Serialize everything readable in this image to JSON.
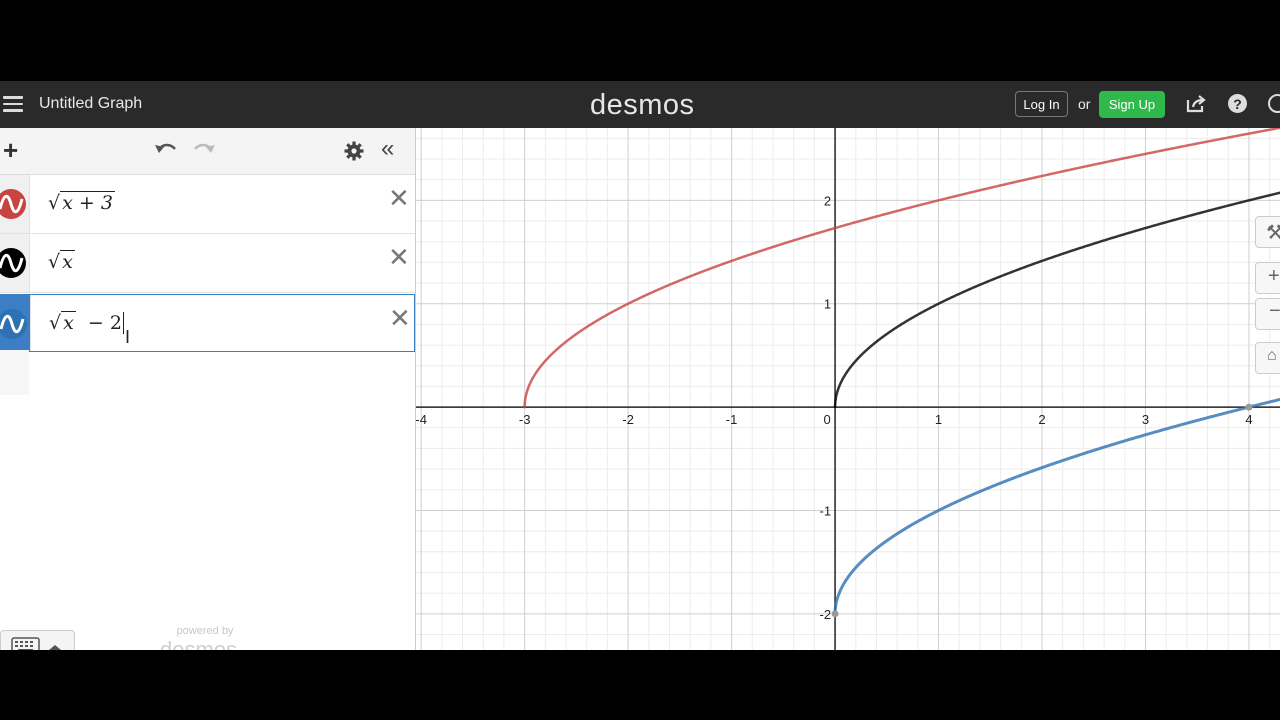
{
  "header": {
    "title": "Untitled Graph",
    "logo": "desmos",
    "login_label": "Log In",
    "or_label": "or",
    "signup_label": "Sign Up",
    "help_label": "?"
  },
  "toolbar": {
    "add_label": "+",
    "collapse_label": "«"
  },
  "expressions": [
    {
      "rad_content": "x + 3",
      "suffix": "",
      "color": "#c74440",
      "selected": false
    },
    {
      "rad_content": "x",
      "suffix": "",
      "color": "#000000",
      "selected": false
    },
    {
      "rad_content": "x",
      "suffix": "− 2",
      "color": "#2d70b3",
      "selected": true
    }
  ],
  "footer": {
    "powered_by": "powered by",
    "powered_logo": "desmos"
  },
  "graph": {
    "x_ticks": [
      "-4",
      "-3",
      "-2",
      "-1",
      "0",
      "1",
      "2",
      "3",
      "4"
    ],
    "y_ticks": [
      "2",
      "1",
      "-1",
      "-2"
    ],
    "curve_colors": {
      "red": "#c74440",
      "black": "#000000",
      "blue": "#2d70b3"
    }
  },
  "chart_data": {
    "type": "line",
    "xlim": [
      -4.05,
      4.3
    ],
    "ylim": [
      -2.35,
      2.7
    ],
    "grid": true,
    "series": [
      {
        "formula": "sqrt(x+3)",
        "x_start": -3,
        "color": "#c74440"
      },
      {
        "formula": "sqrt(x)",
        "x_start": 0,
        "color": "#000000"
      },
      {
        "formula": "sqrt(x)-2",
        "x_start": 0,
        "color": "#2d70b3"
      }
    ]
  }
}
